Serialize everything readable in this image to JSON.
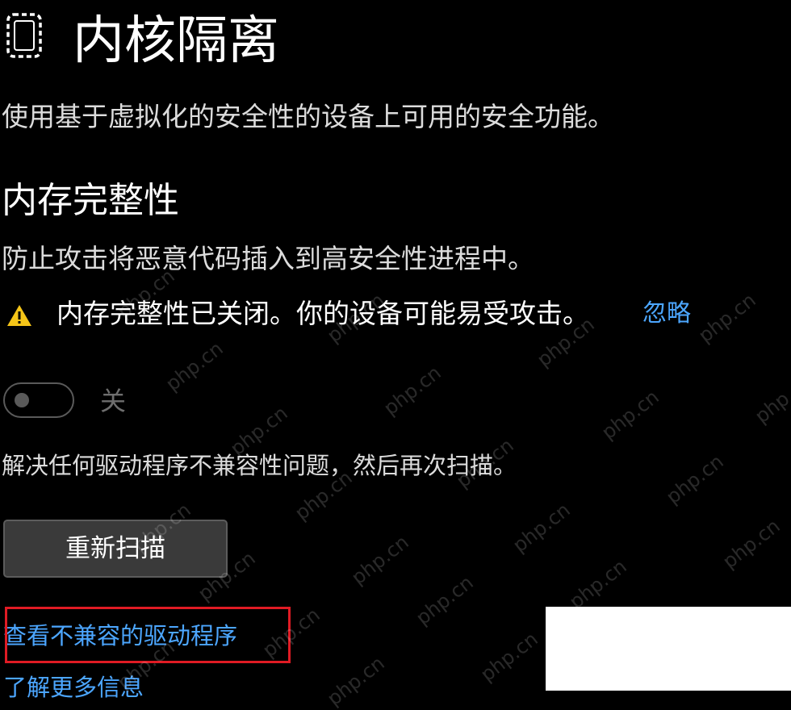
{
  "header": {
    "icon": "core-isolation-chip-icon",
    "title": "内核隔离",
    "description": "使用基于虚拟化的安全性的设备上可用的安全功能。"
  },
  "memory_integrity": {
    "title": "内存完整性",
    "description": "防止攻击将恶意代码插入到高安全性进程中。",
    "warning_icon": "warning-triangle-icon",
    "warning_text": "内存完整性已关闭。你的设备可能易受攻击。",
    "dismiss_label": "忽略",
    "toggle_state": "off",
    "toggle_label": "关",
    "fix_text": "解决任何驱动程序不兼容性问题，然后再次扫描。",
    "rescan_label": "重新扫描",
    "view_drivers_link": "查看不兼容的驱动程序",
    "learn_more_link": "了解更多信息"
  },
  "watermark": "php.cn",
  "colors": {
    "background": "#000000",
    "link": "#4ca6ff",
    "warning": "#f5c518",
    "highlight": "#e01b24",
    "button_bg": "#3a3a3a"
  }
}
